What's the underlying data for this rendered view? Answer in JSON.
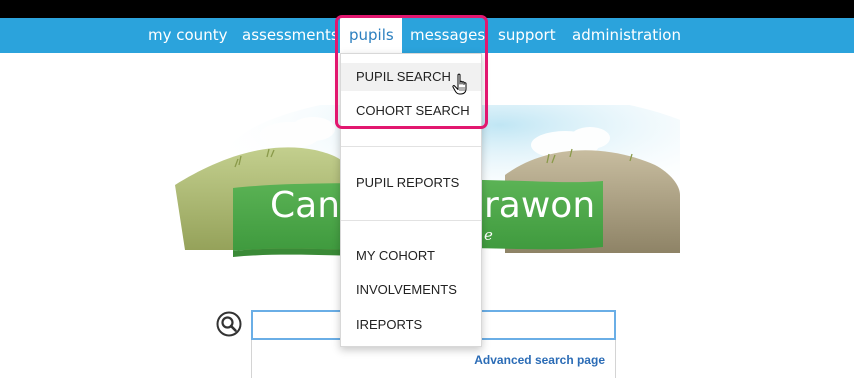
{
  "nav": {
    "items": [
      {
        "label": "my county"
      },
      {
        "label": "assessments"
      },
      {
        "label": "pupils"
      },
      {
        "label": "messages"
      },
      {
        "label": "support"
      },
      {
        "label": "administration"
      }
    ],
    "active": "pupils"
  },
  "dropdown": {
    "items": [
      {
        "label": "PUPIL SEARCH"
      },
      {
        "label": "COHORT SEARCH"
      },
      {
        "label": "PUPIL REPORTS"
      },
      {
        "label": "MY COHORT"
      },
      {
        "label": "INVOLVEMENTS"
      },
      {
        "label": "IREPORTS"
      }
    ],
    "hovered": "PUPIL SEARCH"
  },
  "banner": {
    "title_left": "Canc",
    "title_right": "rawon",
    "subtitle": "e"
  },
  "search": {
    "value": "",
    "advanced_link": "Advanced search page"
  },
  "colors": {
    "navbar": "#2ba3dc",
    "highlight": "#e2176f",
    "banner_green": "#4fa64a",
    "link": "#2b6cb6"
  }
}
